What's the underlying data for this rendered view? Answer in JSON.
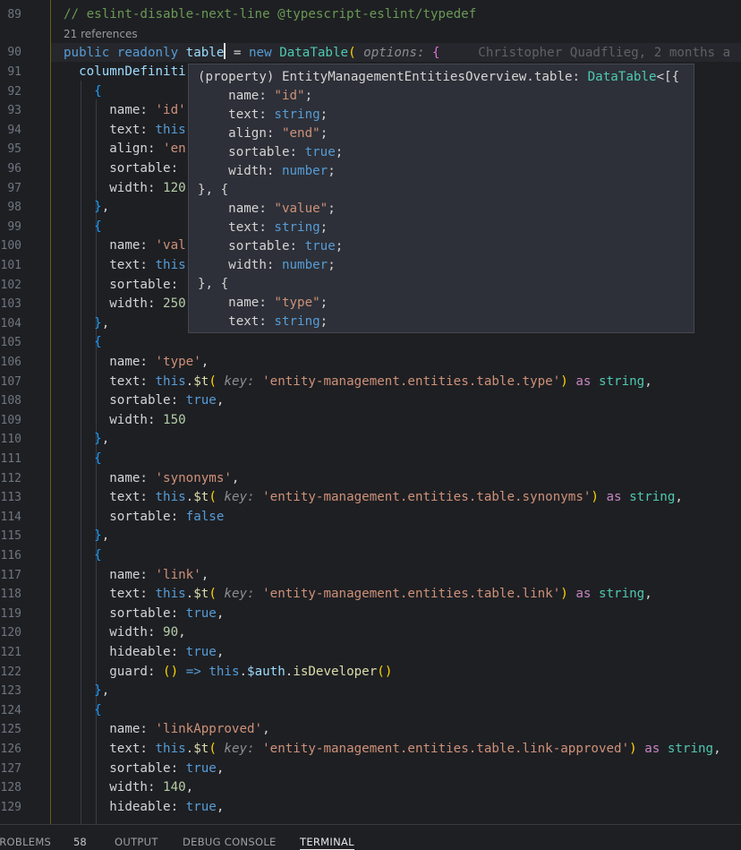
{
  "editor": {
    "codelens": "21 references",
    "blame": "Christopher Quadflieg, 2 months a",
    "lines": [
      {
        "n": "89",
        "t": [
          [
            "c-com",
            "// eslint-disable-next-line @typescript-eslint/typedef"
          ]
        ]
      },
      {
        "n": "90",
        "t": [
          [
            "c-kw",
            "public "
          ],
          [
            "c-kw",
            "readonly "
          ],
          [
            "c-var",
            "table"
          ],
          [
            "cursor",
            ""
          ],
          [
            "c-prop",
            " = "
          ],
          [
            "c-kw",
            "new "
          ],
          [
            "c-type",
            "DataTable"
          ],
          [
            "b-y",
            "( "
          ],
          [
            "c-hint",
            "options: "
          ],
          [
            "b-p",
            "{"
          ]
        ]
      },
      {
        "n": "91",
        "t": [
          [
            "c-prop",
            "  "
          ],
          [
            "c-var",
            "columnDefiniti"
          ]
        ]
      },
      {
        "n": "92",
        "t": [
          [
            "c-prop",
            "    "
          ],
          [
            "b-b",
            "{"
          ]
        ]
      },
      {
        "n": "93",
        "t": [
          [
            "c-prop",
            "      name: "
          ],
          [
            "c-str",
            "'id'"
          ]
        ]
      },
      {
        "n": "94",
        "t": [
          [
            "c-prop",
            "      text: "
          ],
          [
            "c-kw",
            "this"
          ]
        ]
      },
      {
        "n": "95",
        "t": [
          [
            "c-prop",
            "      align: "
          ],
          [
            "c-str",
            "'en"
          ]
        ]
      },
      {
        "n": "96",
        "t": [
          [
            "c-prop",
            "      sortable:"
          ]
        ]
      },
      {
        "n": "97",
        "t": [
          [
            "c-prop",
            "      width: "
          ],
          [
            "c-num",
            "120"
          ]
        ]
      },
      {
        "n": "98",
        "t": [
          [
            "c-prop",
            "    "
          ],
          [
            "b-b",
            "}"
          ],
          [
            "c-prop",
            ","
          ]
        ]
      },
      {
        "n": "99",
        "t": [
          [
            "c-prop",
            "    "
          ],
          [
            "b-b",
            "{"
          ]
        ]
      },
      {
        "n": "100",
        "t": [
          [
            "c-prop",
            "      name: "
          ],
          [
            "c-str",
            "'val"
          ]
        ]
      },
      {
        "n": "101",
        "t": [
          [
            "c-prop",
            "      text: "
          ],
          [
            "c-kw",
            "this"
          ]
        ]
      },
      {
        "n": "102",
        "t": [
          [
            "c-prop",
            "      sortable: "
          ]
        ]
      },
      {
        "n": "103",
        "t": [
          [
            "c-prop",
            "      width: "
          ],
          [
            "c-num",
            "250"
          ]
        ]
      },
      {
        "n": "104",
        "t": [
          [
            "c-prop",
            "    "
          ],
          [
            "b-b",
            "}"
          ],
          [
            "c-prop",
            ","
          ]
        ]
      },
      {
        "n": "105",
        "t": [
          [
            "c-prop",
            "    "
          ],
          [
            "b-b",
            "{"
          ]
        ]
      },
      {
        "n": "106",
        "t": [
          [
            "c-prop",
            "      name: "
          ],
          [
            "c-str",
            "'type'"
          ],
          [
            "c-prop",
            ","
          ]
        ]
      },
      {
        "n": "107",
        "t": [
          [
            "c-prop",
            "      text: "
          ],
          [
            "c-kw",
            "this"
          ],
          [
            "c-prop",
            "."
          ],
          [
            "c-fn",
            "$t"
          ],
          [
            "b-y",
            "( "
          ],
          [
            "c-hint",
            "key: "
          ],
          [
            "c-str",
            "'entity-management.entities.table.type'"
          ],
          [
            "b-y",
            ")"
          ],
          [
            "c-prop",
            " "
          ],
          [
            "c-kw2",
            "as "
          ],
          [
            "c-type",
            "string"
          ],
          [
            "c-prop",
            ","
          ]
        ]
      },
      {
        "n": "108",
        "t": [
          [
            "c-prop",
            "      sortable: "
          ],
          [
            "c-kw",
            "true"
          ],
          [
            "c-prop",
            ","
          ]
        ]
      },
      {
        "n": "109",
        "t": [
          [
            "c-prop",
            "      width: "
          ],
          [
            "c-num",
            "150"
          ]
        ]
      },
      {
        "n": "110",
        "t": [
          [
            "c-prop",
            "    "
          ],
          [
            "b-b",
            "}"
          ],
          [
            "c-prop",
            ","
          ]
        ]
      },
      {
        "n": "111",
        "t": [
          [
            "c-prop",
            "    "
          ],
          [
            "b-b",
            "{"
          ]
        ]
      },
      {
        "n": "112",
        "t": [
          [
            "c-prop",
            "      name: "
          ],
          [
            "c-str",
            "'synonyms'"
          ],
          [
            "c-prop",
            ","
          ]
        ]
      },
      {
        "n": "113",
        "t": [
          [
            "c-prop",
            "      text: "
          ],
          [
            "c-kw",
            "this"
          ],
          [
            "c-prop",
            "."
          ],
          [
            "c-fn",
            "$t"
          ],
          [
            "b-y",
            "( "
          ],
          [
            "c-hint",
            "key: "
          ],
          [
            "c-str",
            "'entity-management.entities.table.synonyms'"
          ],
          [
            "b-y",
            ")"
          ],
          [
            "c-prop",
            " "
          ],
          [
            "c-kw2",
            "as "
          ],
          [
            "c-type",
            "string"
          ],
          [
            "c-prop",
            ","
          ]
        ]
      },
      {
        "n": "114",
        "t": [
          [
            "c-prop",
            "      sortable: "
          ],
          [
            "c-kw",
            "false"
          ]
        ]
      },
      {
        "n": "115",
        "t": [
          [
            "c-prop",
            "    "
          ],
          [
            "b-b",
            "}"
          ],
          [
            "c-prop",
            ","
          ]
        ]
      },
      {
        "n": "116",
        "t": [
          [
            "c-prop",
            "    "
          ],
          [
            "b-b",
            "{"
          ]
        ]
      },
      {
        "n": "117",
        "t": [
          [
            "c-prop",
            "      name: "
          ],
          [
            "c-str",
            "'link'"
          ],
          [
            "c-prop",
            ","
          ]
        ]
      },
      {
        "n": "118",
        "t": [
          [
            "c-prop",
            "      text: "
          ],
          [
            "c-kw",
            "this"
          ],
          [
            "c-prop",
            "."
          ],
          [
            "c-fn",
            "$t"
          ],
          [
            "b-y",
            "( "
          ],
          [
            "c-hint",
            "key: "
          ],
          [
            "c-str",
            "'entity-management.entities.table.link'"
          ],
          [
            "b-y",
            ")"
          ],
          [
            "c-prop",
            " "
          ],
          [
            "c-kw2",
            "as "
          ],
          [
            "c-type",
            "string"
          ],
          [
            "c-prop",
            ","
          ]
        ]
      },
      {
        "n": "119",
        "t": [
          [
            "c-prop",
            "      sortable: "
          ],
          [
            "c-kw",
            "true"
          ],
          [
            "c-prop",
            ","
          ]
        ]
      },
      {
        "n": "120",
        "t": [
          [
            "c-prop",
            "      width: "
          ],
          [
            "c-num",
            "90"
          ],
          [
            "c-prop",
            ","
          ]
        ]
      },
      {
        "n": "121",
        "t": [
          [
            "c-prop",
            "      hideable: "
          ],
          [
            "c-kw",
            "true"
          ],
          [
            "c-prop",
            ","
          ]
        ]
      },
      {
        "n": "122",
        "t": [
          [
            "c-prop",
            "      guard: "
          ],
          [
            "b-y",
            "()"
          ],
          [
            "c-prop",
            " "
          ],
          [
            "c-kw",
            "=>"
          ],
          [
            "c-prop",
            " "
          ],
          [
            "c-kw",
            "this"
          ],
          [
            "c-prop",
            "."
          ],
          [
            "c-var",
            "$auth"
          ],
          [
            "c-prop",
            "."
          ],
          [
            "c-fn",
            "isDeveloper"
          ],
          [
            "b-y",
            "()"
          ]
        ]
      },
      {
        "n": "123",
        "t": [
          [
            "c-prop",
            "    "
          ],
          [
            "b-b",
            "}"
          ],
          [
            "c-prop",
            ","
          ]
        ]
      },
      {
        "n": "124",
        "t": [
          [
            "c-prop",
            "    "
          ],
          [
            "b-b",
            "{"
          ]
        ]
      },
      {
        "n": "125",
        "t": [
          [
            "c-prop",
            "      name: "
          ],
          [
            "c-str",
            "'linkApproved'"
          ],
          [
            "c-prop",
            ","
          ]
        ]
      },
      {
        "n": "126",
        "t": [
          [
            "c-prop",
            "      text: "
          ],
          [
            "c-kw",
            "this"
          ],
          [
            "c-prop",
            "."
          ],
          [
            "c-fn",
            "$t"
          ],
          [
            "b-y",
            "( "
          ],
          [
            "c-hint",
            "key: "
          ],
          [
            "c-str",
            "'entity-management.entities.table.link-approved'"
          ],
          [
            "b-y",
            ")"
          ],
          [
            "c-prop",
            " "
          ],
          [
            "c-kw2",
            "as "
          ],
          [
            "c-type",
            "string"
          ],
          [
            "c-prop",
            ","
          ]
        ]
      },
      {
        "n": "127",
        "t": [
          [
            "c-prop",
            "      sortable: "
          ],
          [
            "c-kw",
            "true"
          ],
          [
            "c-prop",
            ","
          ]
        ]
      },
      {
        "n": "128",
        "t": [
          [
            "c-prop",
            "      width: "
          ],
          [
            "c-num",
            "140"
          ],
          [
            "c-prop",
            ","
          ]
        ]
      },
      {
        "n": "129",
        "t": [
          [
            "c-prop",
            "      hideable: "
          ],
          [
            "c-kw",
            "true"
          ],
          [
            "c-prop",
            ","
          ]
        ]
      }
    ]
  },
  "hover": {
    "lines": [
      [
        [
          "",
          "(property) EntityManagementEntitiesOverview.table: "
        ],
        [
          "t",
          "DataTable"
        ],
        [
          "",
          "<[{"
        ]
      ],
      [
        [
          "",
          "    name: "
        ],
        [
          "s",
          "\"id\""
        ],
        [
          "",
          ";"
        ]
      ],
      [
        [
          "",
          "    text: "
        ],
        [
          "k",
          "string"
        ],
        [
          "",
          ";"
        ]
      ],
      [
        [
          "",
          "    align: "
        ],
        [
          "s",
          "\"end\""
        ],
        [
          "",
          ";"
        ]
      ],
      [
        [
          "",
          "    sortable: "
        ],
        [
          "k",
          "true"
        ],
        [
          "",
          ";"
        ]
      ],
      [
        [
          "",
          "    width: "
        ],
        [
          "k",
          "number"
        ],
        [
          "",
          ";"
        ]
      ],
      [
        [
          "",
          "}, {"
        ]
      ],
      [
        [
          "",
          "    name: "
        ],
        [
          "s",
          "\"value\""
        ],
        [
          "",
          ";"
        ]
      ],
      [
        [
          "",
          "    text: "
        ],
        [
          "k",
          "string"
        ],
        [
          "",
          ";"
        ]
      ],
      [
        [
          "",
          "    sortable: "
        ],
        [
          "k",
          "true"
        ],
        [
          "",
          ";"
        ]
      ],
      [
        [
          "",
          "    width: "
        ],
        [
          "k",
          "number"
        ],
        [
          "",
          ";"
        ]
      ],
      [
        [
          "",
          "}, {"
        ]
      ],
      [
        [
          "",
          "    name: "
        ],
        [
          "s",
          "\"type\""
        ],
        [
          "",
          ";"
        ]
      ],
      [
        [
          "",
          "    text: "
        ],
        [
          "k",
          "string"
        ],
        [
          "",
          ";"
        ]
      ]
    ]
  },
  "panel": {
    "tabs": [
      {
        "label": "PROBLEMS",
        "active": false
      },
      {
        "label": "OUTPUT",
        "active": false
      },
      {
        "label": "DEBUG CONSOLE",
        "active": false
      },
      {
        "label": "TERMINAL",
        "active": true
      }
    ],
    "problems_count": "58"
  },
  "colors": {
    "background": "#1e1f23",
    "hover_background": "#2d3038",
    "gutter_border": "#6b5a17"
  }
}
